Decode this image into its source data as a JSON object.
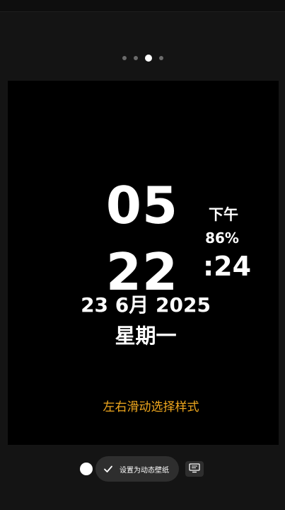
{
  "clock": {
    "hour": "05",
    "minute": "22",
    "ampm": "下午",
    "battery": "86%",
    "seconds": ":24",
    "date": "23 6月 2025",
    "weekday": "星期一"
  },
  "hint": "左右滑动选择样式",
  "pager": {
    "count": 4,
    "active_index": 2
  },
  "bottom_bar": {
    "set_wallpaper_label": "设置为动态壁纸"
  },
  "colors": {
    "background": "#141414",
    "preview_background": "#000000",
    "hint_color": "#f0a81e",
    "button_background": "#2e2e2e"
  },
  "icons": {
    "check": "check-icon",
    "display": "display-settings-icon"
  }
}
